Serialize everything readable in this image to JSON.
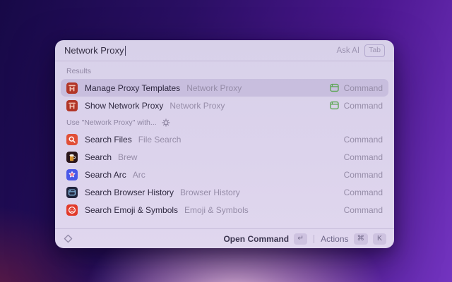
{
  "search": {
    "value": "Network Proxy",
    "ask_ai_label": "Ask AI",
    "tab_key": "Tab"
  },
  "results_header": "Results",
  "use_with_header": "Use \"Network Proxy\" with...",
  "results": [
    {
      "title": "Manage Proxy Templates",
      "subtitle": "Network Proxy",
      "type_label": "Command",
      "icon": "proxy-icon",
      "selected": true,
      "accessory": "command-accessory-icon"
    },
    {
      "title": "Show Network Proxy",
      "subtitle": "Network Proxy",
      "type_label": "Command",
      "icon": "proxy-icon",
      "selected": false,
      "accessory": "command-accessory-icon"
    }
  ],
  "fallback_results": [
    {
      "title": "Search Files",
      "subtitle": "File Search",
      "type_label": "Command",
      "icon": "file-search-icon",
      "selected": false
    },
    {
      "title": "Search",
      "subtitle": "Brew",
      "type_label": "Command",
      "icon": "brew-icon",
      "selected": false
    },
    {
      "title": "Search Arc",
      "subtitle": "Arc",
      "type_label": "Command",
      "icon": "arc-icon",
      "selected": false
    },
    {
      "title": "Search Browser History",
      "subtitle": "Browser History",
      "type_label": "Command",
      "icon": "browser-history-icon",
      "selected": false
    },
    {
      "title": "Search Emoji & Symbols",
      "subtitle": "Emoji & Symbols",
      "type_label": "Command",
      "icon": "emoji-icon",
      "selected": false
    }
  ],
  "footer": {
    "open_label": "Open Command",
    "return_key": "↵",
    "actions_label": "Actions",
    "cmd_key": "⌘",
    "k_key": "K"
  },
  "colors": {
    "accessory_green": "#5da655",
    "selection_tint": "#c9bfe0",
    "window_tint": "#dcd4ec",
    "background_purple": "#4c1790"
  }
}
